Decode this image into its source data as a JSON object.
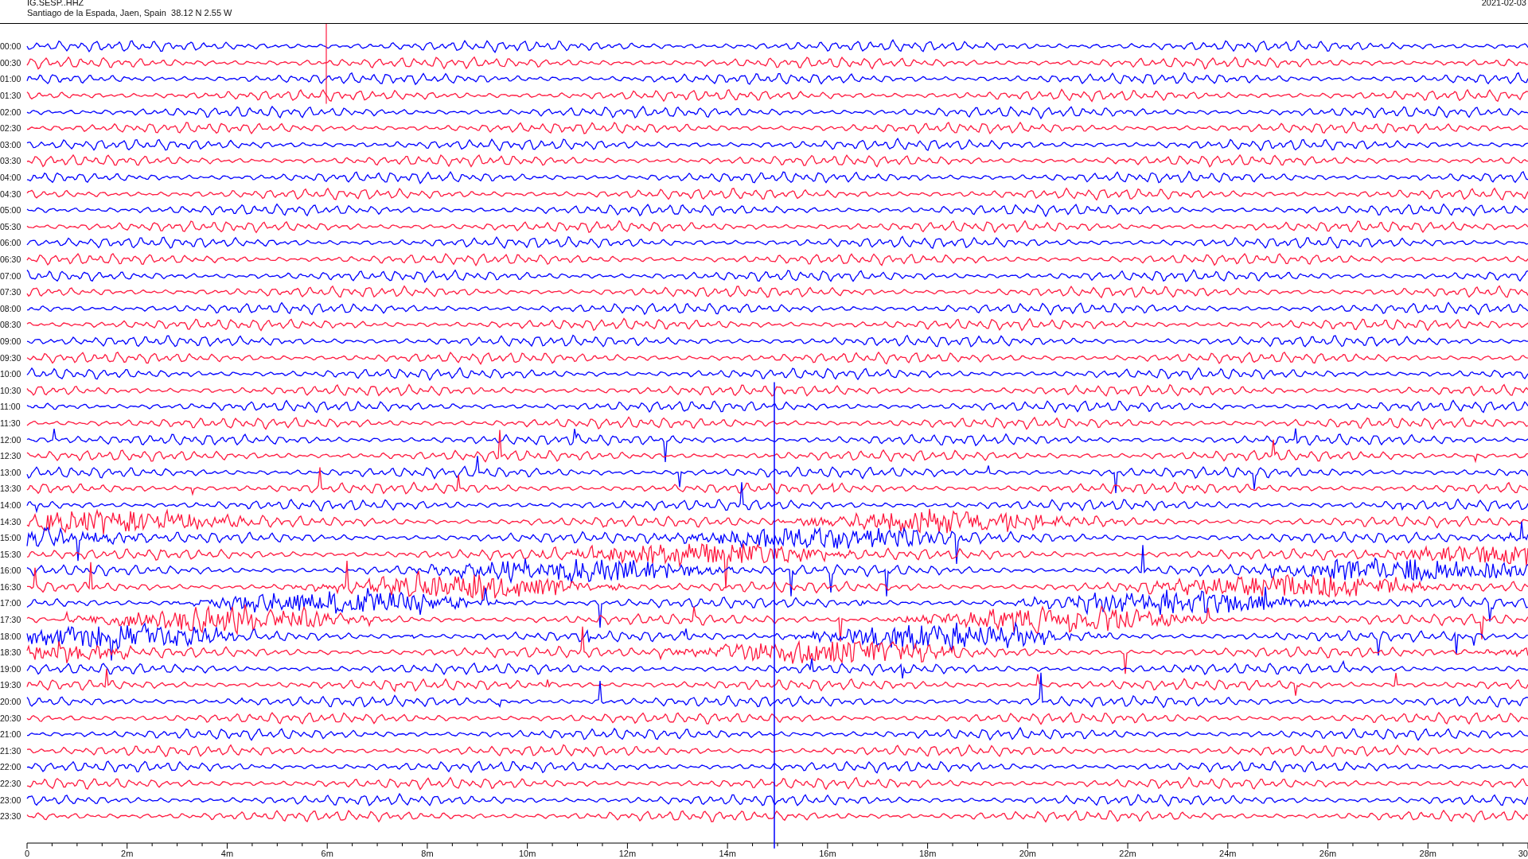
{
  "header": {
    "station": "IG.SESP..HHZ",
    "location": "Santiago de la Espada, Jaen, Spain  38.12 N 2.55 W",
    "date": "2021-02-03"
  },
  "rows": [
    {
      "time": "00:00",
      "color": "#0000ff"
    },
    {
      "time": "00:30",
      "color": "#ff1a40"
    },
    {
      "time": "01:00",
      "color": "#0000ff"
    },
    {
      "time": "01:30",
      "color": "#ff1a40"
    },
    {
      "time": "02:00",
      "color": "#0000ff"
    },
    {
      "time": "02:30",
      "color": "#ff1a40"
    },
    {
      "time": "03:00",
      "color": "#0000ff"
    },
    {
      "time": "03:30",
      "color": "#ff1a40"
    },
    {
      "time": "04:00",
      "color": "#0000ff"
    },
    {
      "time": "04:30",
      "color": "#ff1a40"
    },
    {
      "time": "05:00",
      "color": "#0000ff"
    },
    {
      "time": "05:30",
      "color": "#ff1a40"
    },
    {
      "time": "06:00",
      "color": "#0000ff"
    },
    {
      "time": "06:30",
      "color": "#ff1a40"
    },
    {
      "time": "07:00",
      "color": "#0000ff"
    },
    {
      "time": "07:30",
      "color": "#ff1a40"
    },
    {
      "time": "08:00",
      "color": "#0000ff"
    },
    {
      "time": "08:30",
      "color": "#ff1a40"
    },
    {
      "time": "09:00",
      "color": "#0000ff"
    },
    {
      "time": "09:30",
      "color": "#ff1a40"
    },
    {
      "time": "10:00",
      "color": "#0000ff"
    },
    {
      "time": "10:30",
      "color": "#ff1a40"
    },
    {
      "time": "11:00",
      "color": "#0000ff"
    },
    {
      "time": "11:30",
      "color": "#ff1a40"
    },
    {
      "time": "12:00",
      "color": "#0000ff"
    },
    {
      "time": "12:30",
      "color": "#ff1a40"
    },
    {
      "time": "13:00",
      "color": "#0000ff"
    },
    {
      "time": "13:30",
      "color": "#ff1a40"
    },
    {
      "time": "14:00",
      "color": "#0000ff"
    },
    {
      "time": "14:30",
      "color": "#ff1a40"
    },
    {
      "time": "15:00",
      "color": "#0000ff"
    },
    {
      "time": "15:30",
      "color": "#ff1a40"
    },
    {
      "time": "16:00",
      "color": "#0000ff"
    },
    {
      "time": "16:30",
      "color": "#ff1a40"
    },
    {
      "time": "17:00",
      "color": "#0000ff"
    },
    {
      "time": "17:30",
      "color": "#ff1a40"
    },
    {
      "time": "18:00",
      "color": "#0000ff"
    },
    {
      "time": "18:30",
      "color": "#ff1a40"
    },
    {
      "time": "19:00",
      "color": "#0000ff"
    },
    {
      "time": "19:30",
      "color": "#ff1a40"
    },
    {
      "time": "20:00",
      "color": "#0000ff"
    },
    {
      "time": "20:30",
      "color": "#ff1a40"
    },
    {
      "time": "21:00",
      "color": "#0000ff"
    },
    {
      "time": "21:30",
      "color": "#ff1a40"
    },
    {
      "time": "22:00",
      "color": "#0000ff"
    },
    {
      "time": "22:30",
      "color": "#ff1a40"
    },
    {
      "time": "23:00",
      "color": "#0000ff"
    },
    {
      "time": "23:30",
      "color": "#ff1a40"
    }
  ],
  "x_axis": {
    "ticks": [
      "0",
      "2m",
      "4m",
      "6m",
      "8m",
      "10m",
      "12m",
      "14m",
      "16m",
      "18m",
      "20m",
      "22m",
      "24m",
      "26m",
      "28m",
      "30"
    ]
  }
}
